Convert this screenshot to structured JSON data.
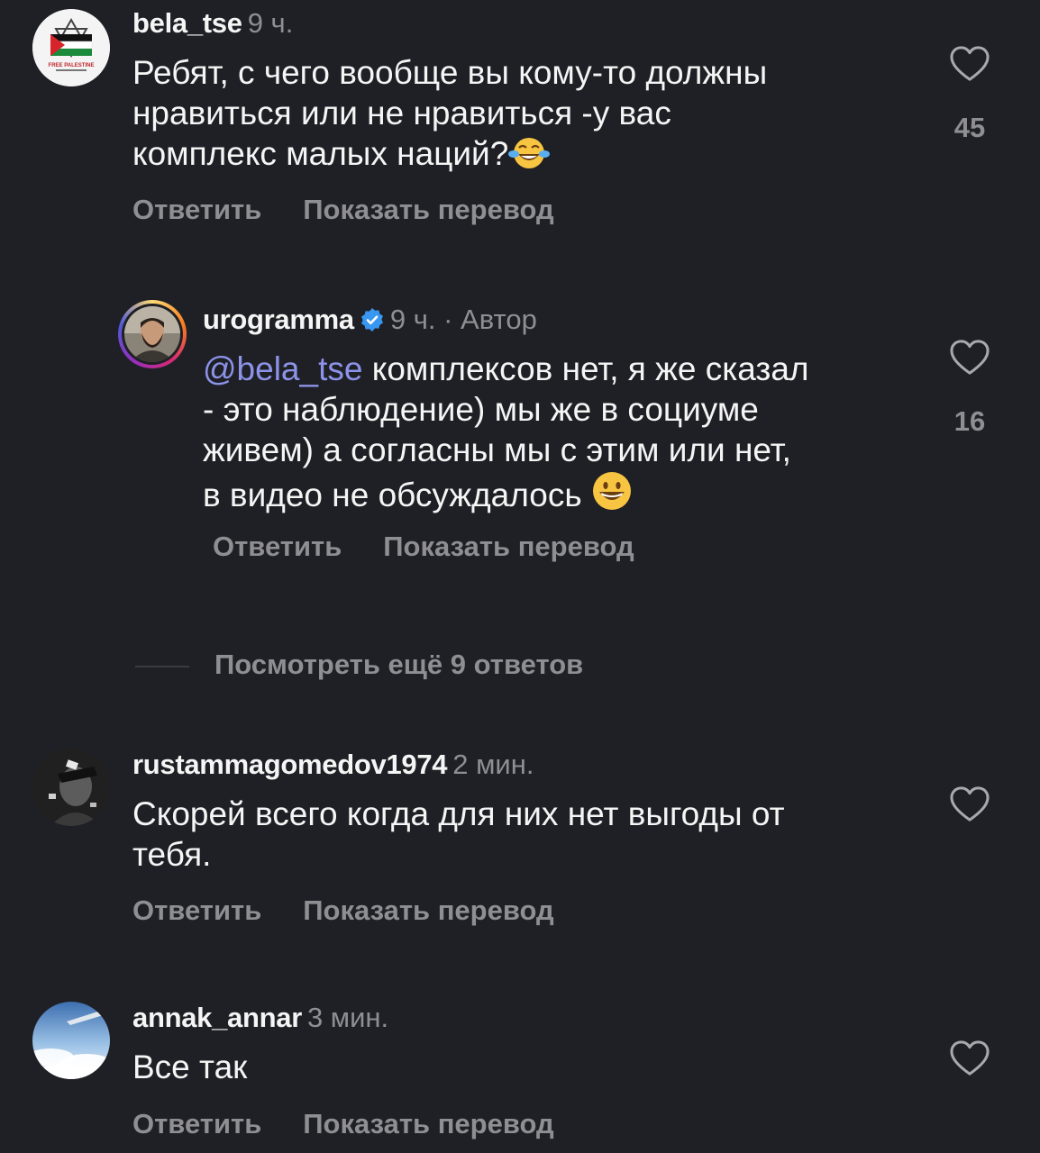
{
  "comments": [
    {
      "username": "bela_tse",
      "time": "9 ч.",
      "lines": [
        "Ребят, с чего вообще вы кому-то должны",
        "нравиться или не нравиться -у вас",
        "комплекс малых наций?"
      ],
      "emoji": "face-with-tears-of-joy",
      "reply_label": "Ответить",
      "translate_label": "Показать перевод",
      "likes": "45",
      "avatar_text": "FREE PALESTINE"
    },
    {
      "username": "urogramma",
      "time": "9 ч. · Автор",
      "mention": "@bela_tse",
      "lines": [
        " комплексов нет, я же сказал",
        "- это наблюдение) мы же в социуме",
        "живем) а согласны мы с этим или нет,",
        "в видео не обсуждалось "
      ],
      "emoji": "grinning-face",
      "reply_label": "Ответить",
      "translate_label": "Показать перевод",
      "likes": "16"
    },
    {
      "username": "rustammagomedov1974",
      "time": "2 мин.",
      "lines": [
        "Скорей всего когда для них нет выгоды от",
        "тебя."
      ],
      "reply_label": "Ответить",
      "translate_label": "Показать перевод"
    },
    {
      "username": "annak_annar",
      "time": "3 мин.",
      "lines": [
        "Все так"
      ],
      "reply_label": "Ответить",
      "translate_label": "Показать перевод"
    }
  ],
  "view_more": "Посмотреть ещё 9 ответов",
  "colors": {
    "background": "#1f2025",
    "muted": "#8e8e93",
    "mention": "#8c93e8",
    "verified": "#3897f0"
  }
}
